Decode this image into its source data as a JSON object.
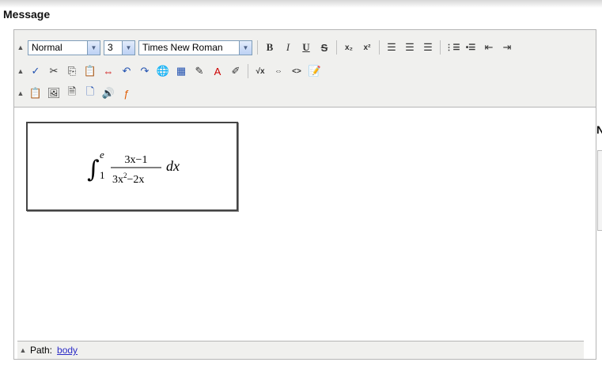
{
  "heading": "Message",
  "right_edge_letter": "N",
  "toolbar": {
    "format_select": "Normal",
    "size_select": "3",
    "font_select": "Times New Roman",
    "collapse_glyph": "▲",
    "dropdown_glyph": "▼",
    "row1": [
      {
        "name": "bold-button",
        "glyph": "B",
        "cls": "bold"
      },
      {
        "name": "italic-button",
        "glyph": "I",
        "cls": "ital"
      },
      {
        "name": "underline-button",
        "glyph": "U",
        "cls": "under"
      },
      {
        "name": "strikethrough-button",
        "glyph": "S",
        "cls": "strike"
      },
      {
        "sep": true
      },
      {
        "name": "subscript-button",
        "glyph": "x₂",
        "cls": "sm"
      },
      {
        "name": "superscript-button",
        "glyph": "x²",
        "cls": "sm"
      },
      {
        "sep": true
      },
      {
        "name": "align-left-button",
        "glyph": "☰",
        "cls": ""
      },
      {
        "name": "align-center-button",
        "glyph": "☰",
        "cls": ""
      },
      {
        "name": "align-right-button",
        "glyph": "☰",
        "cls": ""
      },
      {
        "sep": true
      },
      {
        "name": "ordered-list-button",
        "glyph": "⋮☰",
        "cls": "sm"
      },
      {
        "name": "unordered-list-button",
        "glyph": "•☰",
        "cls": "sm"
      },
      {
        "name": "outdent-button",
        "glyph": "⇤",
        "cls": ""
      },
      {
        "name": "indent-button",
        "glyph": "⇥",
        "cls": ""
      }
    ],
    "row2": [
      {
        "name": "spellcheck-button",
        "glyph": "✓",
        "cls": "blue"
      },
      {
        "name": "cut-button",
        "glyph": "✂",
        "cls": ""
      },
      {
        "name": "copy-button",
        "glyph": "⎘",
        "cls": ""
      },
      {
        "name": "paste-button",
        "glyph": "📋",
        "cls": ""
      },
      {
        "name": "anchor-button",
        "glyph": "⇔",
        "cls": "red"
      },
      {
        "name": "undo-button",
        "glyph": "↶",
        "cls": "blue"
      },
      {
        "name": "redo-button",
        "glyph": "↷",
        "cls": "blue"
      },
      {
        "name": "link-button",
        "glyph": "🌐",
        "cls": ""
      },
      {
        "name": "table-button",
        "glyph": "▦",
        "cls": "blue"
      },
      {
        "name": "pen-button",
        "glyph": "✎",
        "cls": ""
      },
      {
        "name": "font-color-button",
        "glyph": "A",
        "cls": "red"
      },
      {
        "name": "highlight-button",
        "glyph": "✐",
        "cls": ""
      },
      {
        "sep": true
      },
      {
        "name": "equation-button",
        "glyph": "√x",
        "cls": "sm"
      },
      {
        "name": "resize-button",
        "glyph": "⇔",
        "cls": "sm"
      },
      {
        "name": "html-source-button",
        "glyph": "<>",
        "cls": "sm"
      },
      {
        "name": "edit-document-button",
        "glyph": "📝",
        "cls": ""
      }
    ],
    "row3": [
      {
        "name": "paste-plain-button",
        "glyph": "📋",
        "cls": ""
      },
      {
        "name": "image-button",
        "glyph": "🖼",
        "cls": ""
      },
      {
        "name": "media-button",
        "glyph": "🗎",
        "cls": ""
      },
      {
        "name": "preview-button",
        "glyph": "🗋",
        "cls": "blue"
      },
      {
        "name": "audio-button",
        "glyph": "🔊",
        "cls": ""
      },
      {
        "name": "flash-button",
        "glyph": "ƒ",
        "cls": "orange"
      }
    ]
  },
  "equation": {
    "integral": "∫",
    "upper": "e",
    "lower": "1",
    "numerator": "3x−1",
    "denominator_base": "3x",
    "denominator_exp": "2",
    "denominator_rest": "−2x",
    "differential": "dx"
  },
  "statusbar": {
    "path_label": "Path:",
    "path_value": "body"
  }
}
